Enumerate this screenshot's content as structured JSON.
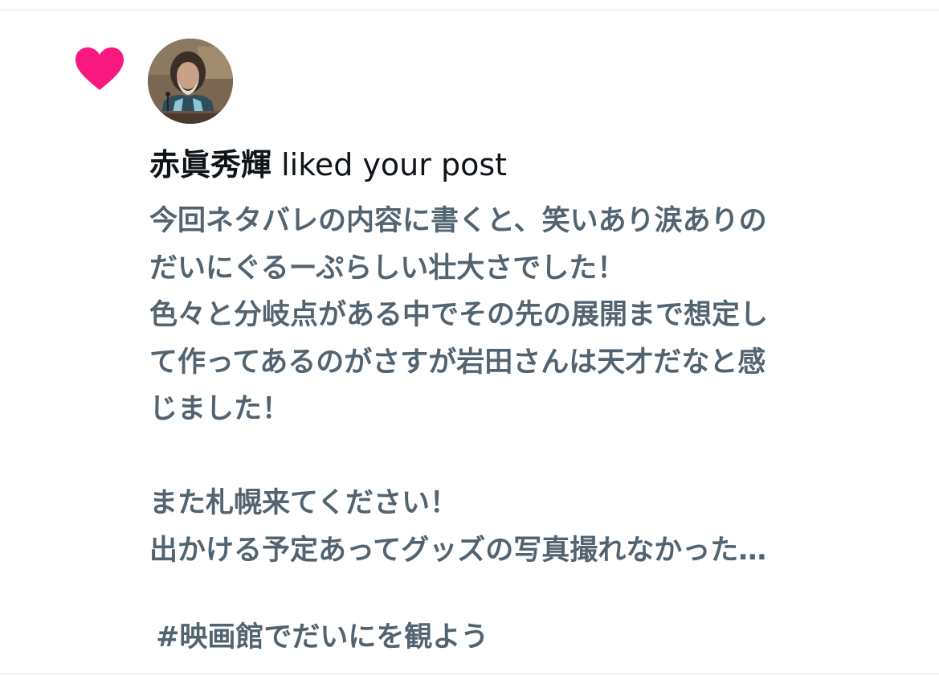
{
  "colors": {
    "heart": "#f91880",
    "text_primary": "#0f1419",
    "text_secondary": "#536471",
    "divider": "#e1e6ea"
  },
  "notification": {
    "icon": "heart-icon",
    "avatar": "user-avatar",
    "user_name": "赤眞秀輝",
    "action_text": " liked your post",
    "post_lines": [
      "今回ネタバレの内容に書くと、笑いあり涙ありの",
      "だいにぐるーぷらしい壮大さでした！",
      "色々と分岐点がある中でその先の展開まで想定し",
      "て作ってあるのがさすが岩田さんは天才だなと感",
      "じました！",
      "",
      "また札幌来てください！",
      "出かける予定あってグッズの写真撮れなかった…"
    ],
    "hashtag": "#映画館でだいにを観よう"
  }
}
